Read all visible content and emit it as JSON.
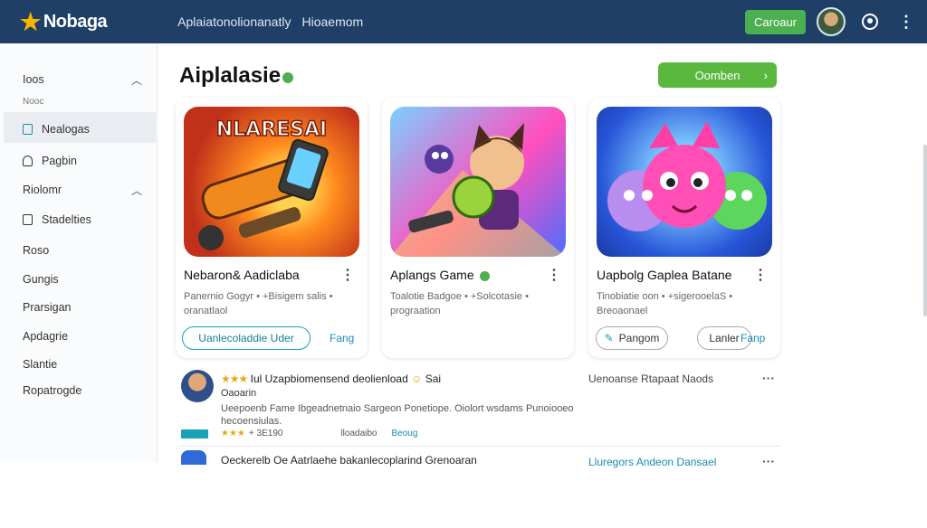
{
  "header": {
    "logo_text": "Nobaga",
    "nav": [
      "Aplaiatonolionanatly",
      "Hioaemom"
    ],
    "cta_label": "Caroaur",
    "colors": {
      "bar": "#1f3f66",
      "accent": "#4caf50",
      "star": "#f7b500"
    }
  },
  "sidebar": {
    "section1": "Ioos",
    "sub1": "Nooc",
    "items_top": [
      "Nealogas",
      "Pagbin"
    ],
    "section2": "Riolomr",
    "items": [
      "Stadelties",
      "Roso",
      "Gungis",
      "Prarsigan",
      "Apdagrie",
      "Slantie",
      "Ropatrogde"
    ]
  },
  "main": {
    "title": "Aiplalasie",
    "top_button": "Oomben",
    "cards": [
      {
        "art_text": "NLARESAI",
        "title": "Nebaron& Aadiclaba",
        "desc": "Panernio Gogyr • +Bisigem salis • oranatlaol",
        "btn_outline": "Uanlecoladdie  Uder",
        "link": "Fang"
      },
      {
        "title": "Aplangs Game",
        "desc": "Toalotie Badgoe • +Solcotasie • prograation",
        "btn_outline": "",
        "link": ""
      },
      {
        "title": "Uapbolg Gaplea Batane",
        "desc": "Tinobiatie oon • +sigerooelaS • Breoaonael",
        "btn_outline": "Pangom",
        "btn_outline2": "Lanler",
        "link": "Fanp"
      }
    ]
  },
  "feed": [
    {
      "stars": "★★★",
      "head": "Iul  Uzapbiomensend deolienload",
      "extra": "Sai",
      "sub": "Oaoarin",
      "body": "Ueepoenb Fame Ibgeadnetnaio Sargeon Ponetiope. Oiolort wsdams Punoiooeo hecoensiulas.",
      "meta_count": "+ 3E190",
      "meta_date": "lloadaibo",
      "meta_link": "Beoug",
      "right": "Uenoanse Rtapaat Naods"
    },
    {
      "stars": "",
      "head": "Oeckerelb Oe Aatrlaehe bakanlecoplarind Grenoaran",
      "right": "Lluregors Andeon Dansael"
    }
  ]
}
